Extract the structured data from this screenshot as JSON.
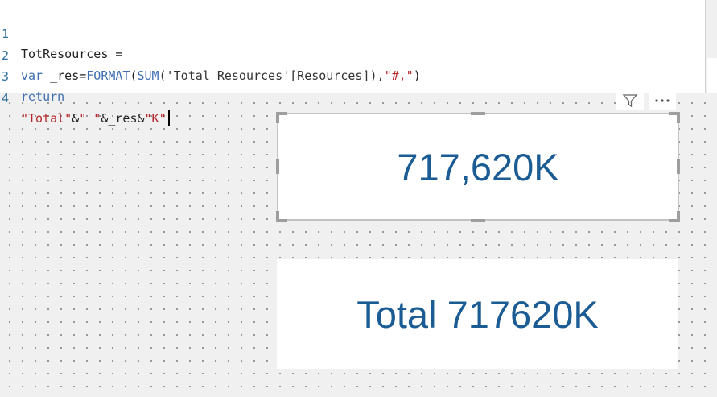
{
  "editor": {
    "lines": [
      {
        "no": "1",
        "tokens": [
          {
            "t": "TotResources =",
            "c": "plain"
          }
        ]
      },
      {
        "no": "2",
        "tokens": [
          {
            "t": "var",
            "c": "kw"
          },
          {
            "t": " _res=",
            "c": "plain"
          },
          {
            "t": "FORMAT",
            "c": "fn"
          },
          {
            "t": "(",
            "c": "plain"
          },
          {
            "t": "SUM",
            "c": "fn"
          },
          {
            "t": "('Total Resources'[Resources]),",
            "c": "tbl"
          },
          {
            "t": "\"#,\"",
            "c": "str"
          },
          {
            "t": ")",
            "c": "plain"
          }
        ]
      },
      {
        "no": "3",
        "tokens": [
          {
            "t": "return",
            "c": "kw"
          }
        ]
      },
      {
        "no": "4",
        "tokens": [
          {
            "t": "\"Total\"",
            "c": "str"
          },
          {
            "t": "&",
            "c": "plain"
          },
          {
            "t": "\" \"",
            "c": "str"
          },
          {
            "t": "&_res&",
            "c": "plain"
          },
          {
            "t": "\"K\"",
            "c": "str"
          }
        ]
      }
    ]
  },
  "icons": {
    "filter": "filter-icon",
    "more": "more-options-icon"
  },
  "cards": {
    "card1_value": "717,620K",
    "card2_value": "Total 717620K"
  },
  "colors": {
    "card_text": "#1b5c94",
    "keyword": "#3f6fb0",
    "string": "#b5262b",
    "line_number": "#2e6f9e"
  }
}
